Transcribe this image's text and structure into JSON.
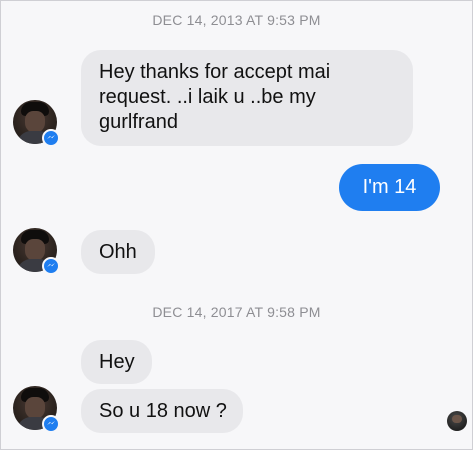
{
  "timestamps": [
    "DEC 14, 2013 AT 9:53 PM",
    "DEC 14, 2017 AT 9:58 PM"
  ],
  "messages": [
    {
      "sender": "other",
      "text": "Hey thanks for accept mai request. ..i laik u ..be my gurlfrand"
    },
    {
      "sender": "me",
      "text": "I'm  14"
    },
    {
      "sender": "other",
      "text": "Ohh"
    },
    {
      "sender": "other",
      "text": "Hey"
    },
    {
      "sender": "other",
      "text": "So u 18 now ?"
    }
  ],
  "icons": {
    "avatar": "contact-avatar",
    "badge": "messenger-badge-icon",
    "seen": "seen-indicator-avatar"
  },
  "colors": {
    "outgoing_bubble": "#1f7ef0",
    "incoming_bubble": "#e8e8eb",
    "timestamp": "#8e8e93",
    "background": "#f7f7f9"
  }
}
